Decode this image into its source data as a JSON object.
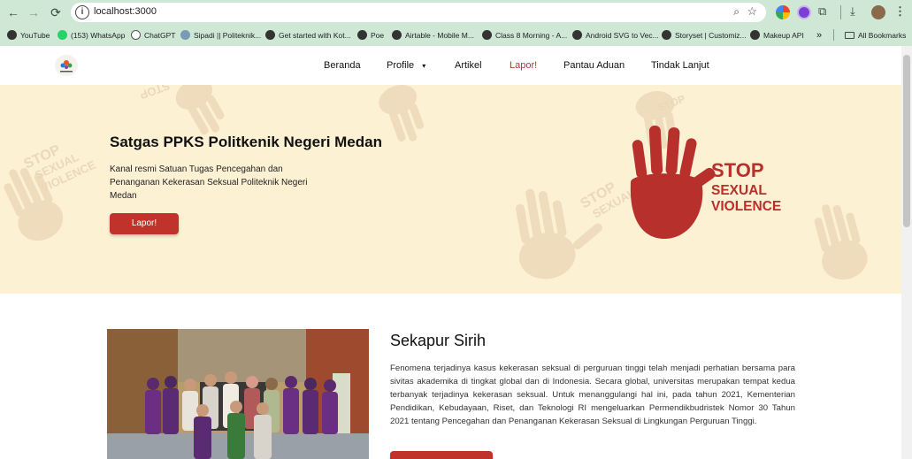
{
  "browser": {
    "url": "localhost:3000",
    "bookmarks": [
      {
        "label": "YouTube",
        "color": "#e52d27"
      },
      {
        "label": "(153) WhatsApp",
        "color": "#25d366"
      },
      {
        "label": "ChatGPT",
        "color": "#555555"
      },
      {
        "label": "Sipadi || Politeknik...",
        "color": "#7a9ab5"
      },
      {
        "label": "Get started with Kot...",
        "color": "#333333"
      },
      {
        "label": "Poe",
        "color": "#333333"
      },
      {
        "label": "Airtable - Mobile M...",
        "color": "#333333"
      },
      {
        "label": "Class 8 Morning - A...",
        "color": "#333333"
      },
      {
        "label": "Android SVG to Vec...",
        "color": "#333333"
      },
      {
        "label": "Storyset | Customiz...",
        "color": "#333333"
      },
      {
        "label": "Makeup API",
        "color": "#333333"
      }
    ],
    "more_label": "»",
    "all_bookmarks_label": "All Bookmarks"
  },
  "nav": {
    "items": [
      {
        "label": "Beranda"
      },
      {
        "label": "Profile"
      },
      {
        "label": "Artikel"
      },
      {
        "label": "Lapor!"
      },
      {
        "label": "Pantau Aduan"
      },
      {
        "label": "Tindak Lanjut"
      }
    ],
    "accent": "#c0302a"
  },
  "hero": {
    "title": "Satgas PPKS Politkenik Negeri Medan",
    "description": "Kanal resmi Satuan Tugas Pencegahan dan Penanganan Kekerasan Seksual Politeknik Negeri Medan",
    "button_label": "Lapor!",
    "logo_lines": [
      "STOP",
      "SEXUAL",
      "VIOLENCE"
    ],
    "background": "#fdf1d4"
  },
  "about": {
    "title": "Sekapur Sirih",
    "text": "Fenomena terjadinya kasus kekerasan seksual di perguruan tinggi telah menjadi perhatian bersama para sivitas akademika di tingkat global dan di Indonesia. Secara global, universitas merupakan tempat kedua terbanyak terjadinya kekerasan seksual. Untuk menanggulangi hal ini, pada tahun 2021, Kementerian Pendidikan, Kebudayaan, Riset, dan Teknologi RI mengeluarkan Permendikbudristek Nomor 30 Tahun 2021 tentang Pencegahan dan Penanganan Kekerasan Seksual di Lingkungan Perguruan Tinggi."
  }
}
